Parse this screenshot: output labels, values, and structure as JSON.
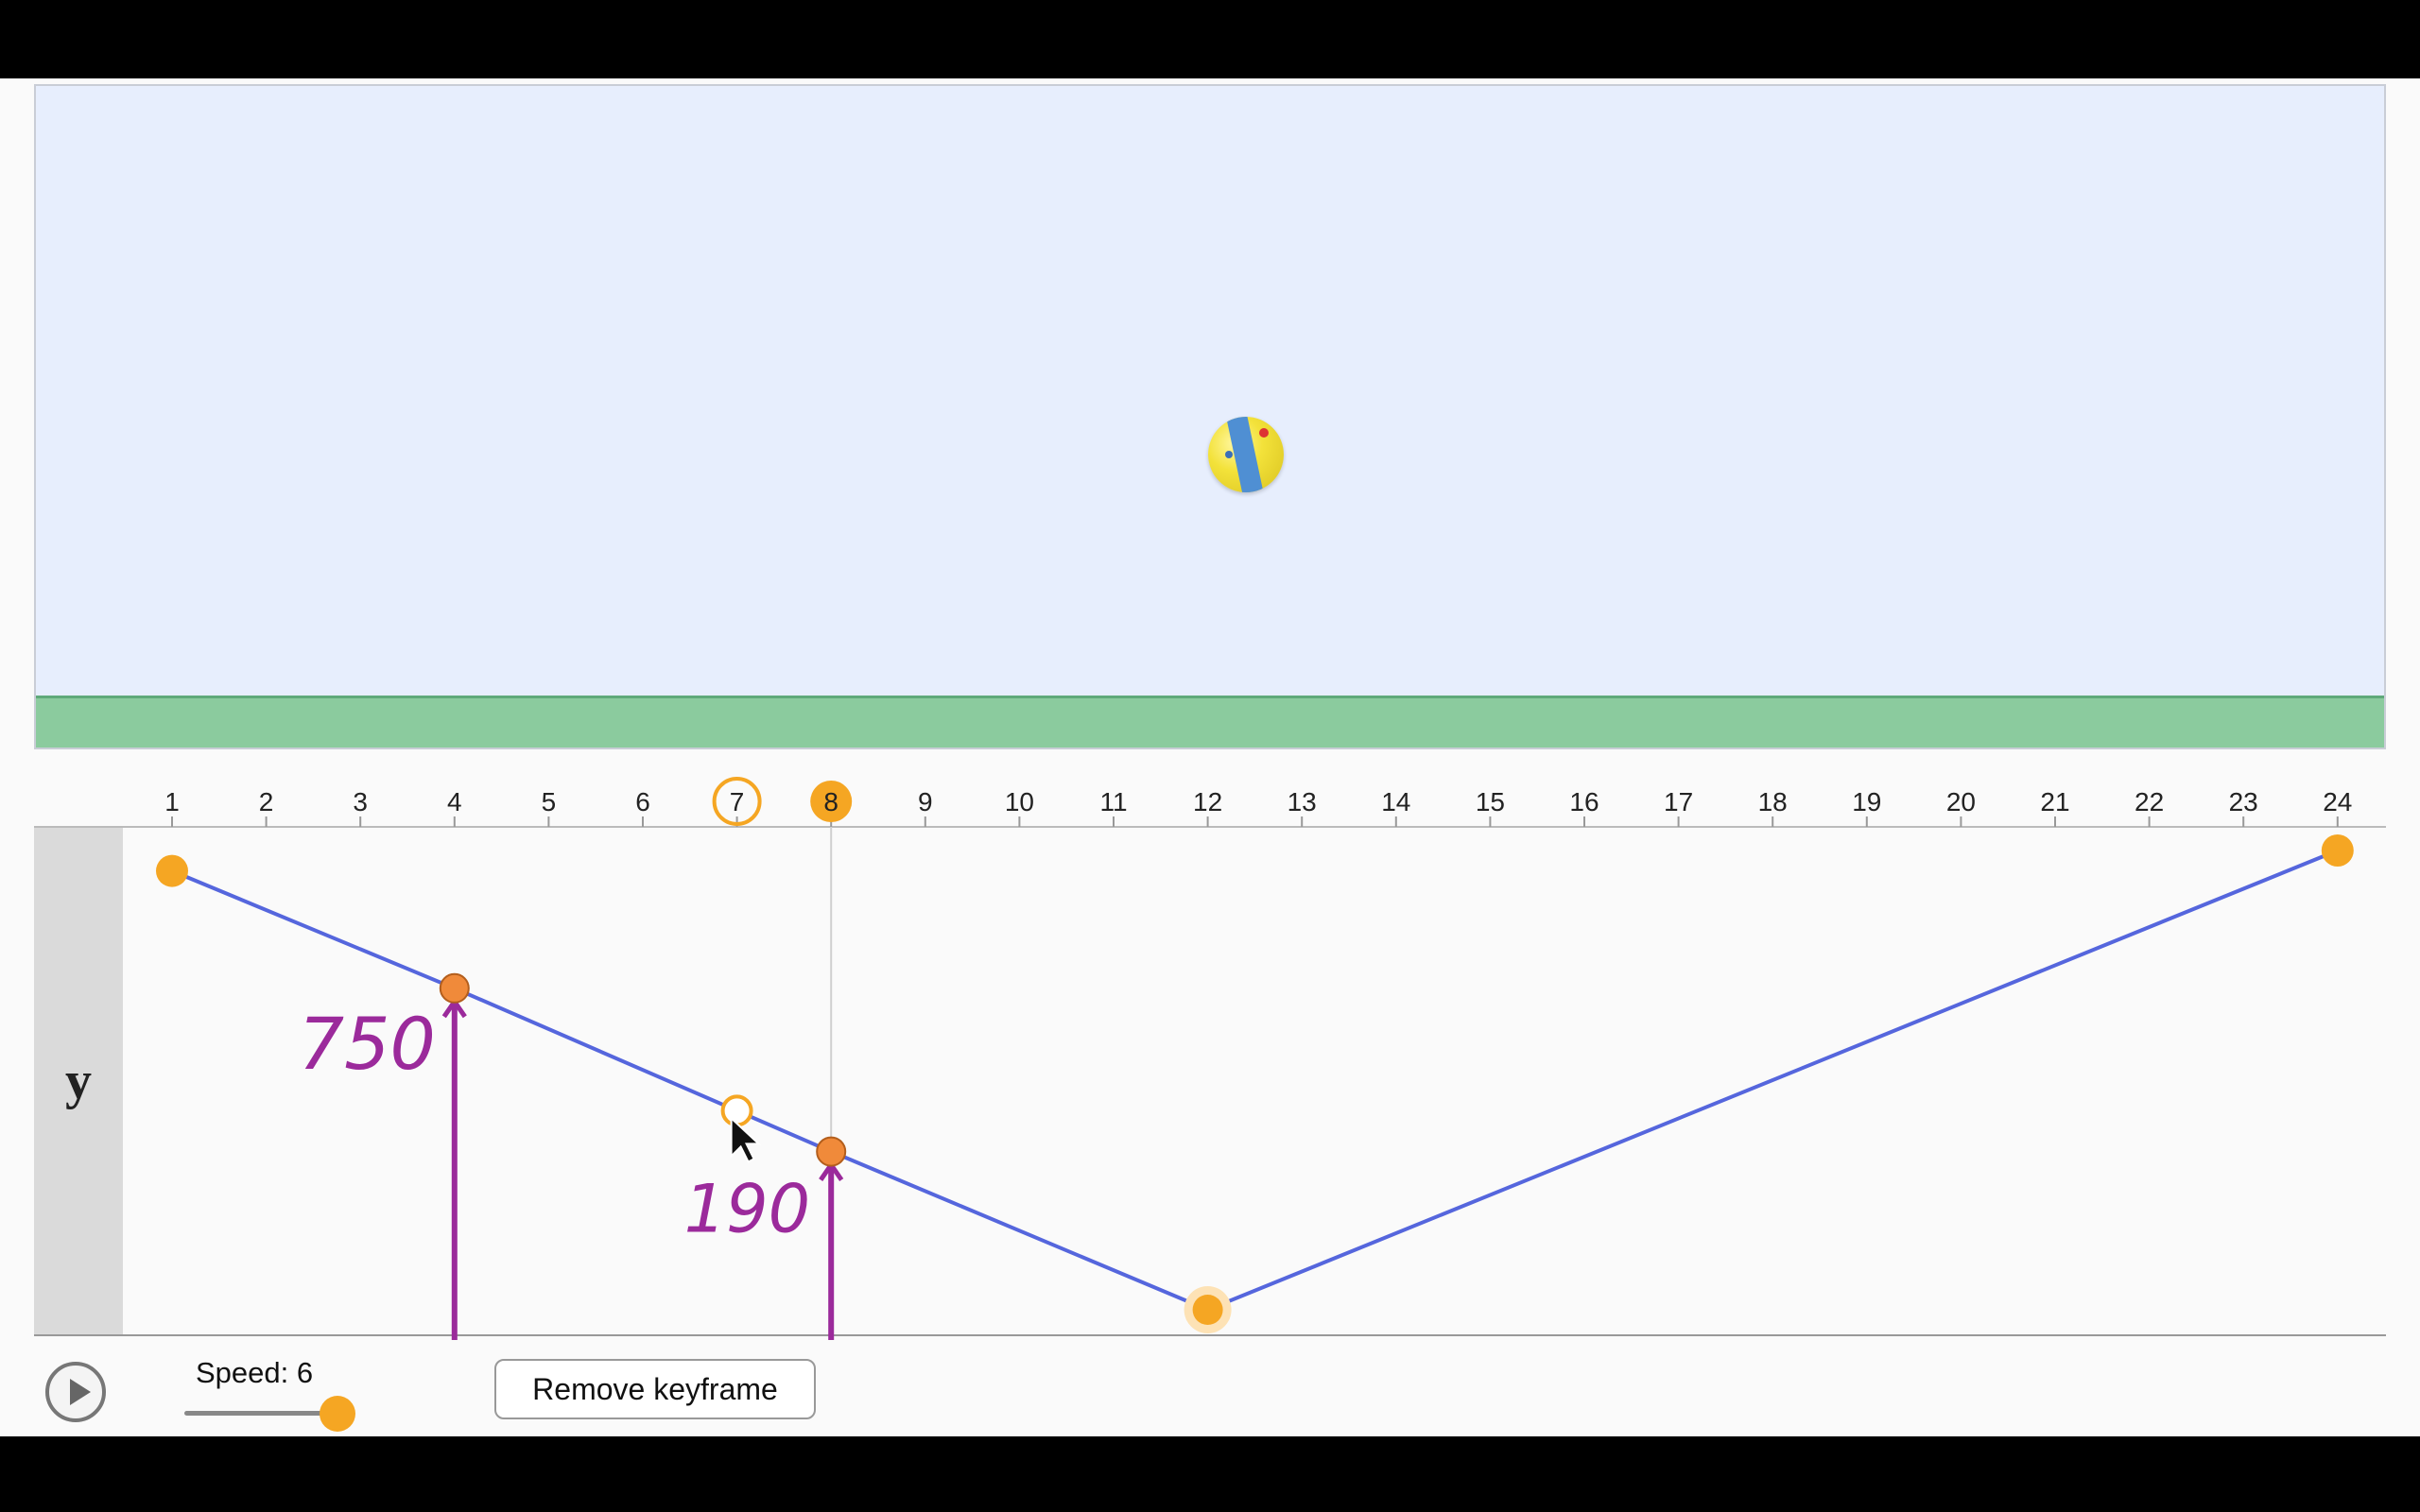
{
  "scene": {
    "sky_color": "#e7eefd",
    "ground_color": "#8bcb9e"
  },
  "timeline": {
    "frames": [
      "1",
      "2",
      "3",
      "4",
      "5",
      "6",
      "7",
      "8",
      "9",
      "10",
      "11",
      "12",
      "13",
      "14",
      "15",
      "16",
      "17",
      "18",
      "19",
      "20",
      "21",
      "22",
      "23",
      "24"
    ],
    "hover_frame": 7,
    "current_frame": 8,
    "track_label": "y",
    "keyframes": [
      {
        "frame": 1,
        "level": 0.91
      },
      {
        "frame": 4,
        "level": 0.68
      },
      {
        "frame": 8,
        "level": 0.36
      },
      {
        "frame": 12,
        "level": 0.05
      },
      {
        "frame": 24,
        "level": 0.95
      }
    ],
    "hover_point": {
      "frame": 7,
      "level": 0.44
    },
    "line_color": "#5566dd",
    "keyframe_color": "#f5a623"
  },
  "annotations": {
    "value_a": "750",
    "value_b": "190",
    "color": "#9b2a9b"
  },
  "controls": {
    "play_icon": "play-icon",
    "speed_label": "Speed: 6",
    "speed_value": 6,
    "remove_keyframe_label": "Remove keyframe"
  }
}
